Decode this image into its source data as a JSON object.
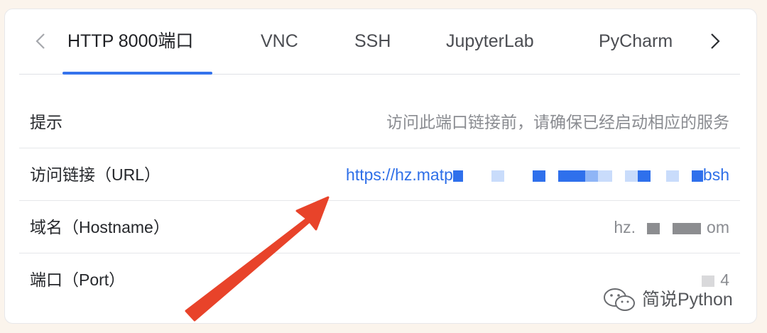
{
  "tabs": [
    {
      "label": "HTTP 8000端口",
      "active": true
    },
    {
      "label": "VNC",
      "active": false
    },
    {
      "label": "SSH",
      "active": false
    },
    {
      "label": "JupyterLab",
      "active": false
    },
    {
      "label": "PyCharm",
      "active": false
    }
  ],
  "rows": {
    "hint": {
      "label": "提示",
      "value": "访问此端口链接前，请确保已经启动相应的服务"
    },
    "url": {
      "label": "访问链接（URL）",
      "value_start": "https://hz.matp",
      "value_end": "bsh"
    },
    "hostname": {
      "label": "域名（Hostname）",
      "value_start": "hz.",
      "value_end": "om"
    },
    "port": {
      "label": "端口（Port）",
      "value_end": "4"
    }
  },
  "watermark": {
    "text": "简说Python"
  },
  "colors": {
    "accent": "#3573ec",
    "link": "#2e6fe8",
    "annotation_arrow": "#e8432a",
    "page_background": "#fbf4ec"
  },
  "icons": {
    "prev": "chevron-left-icon",
    "next": "chevron-right-icon",
    "watermark": "wechat-icon"
  }
}
